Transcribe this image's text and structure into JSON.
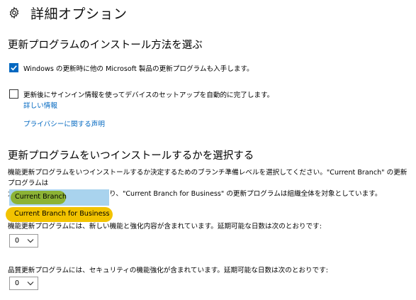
{
  "header": {
    "title": "詳細オプション",
    "icon": "gear-icon"
  },
  "install_section": {
    "title": "更新プログラムのインストール方法を選ぶ",
    "option1": {
      "label": "Windows の更新時に他の Microsoft 製品の更新プログラムも入手します。",
      "checked": true
    },
    "option2": {
      "label": "更新後にサインイン情報を使ってデバイスのセットアップを自動的に完了します。",
      "checked": false
    },
    "details_link": "詳しい情報",
    "privacy_link": "プライバシーに関する声明"
  },
  "timing_section": {
    "title": "更新プログラムをいつインストールするかを選択する",
    "description_line1": "機能更新プログラムをいつインストールするか決定するためのブランチ準備レベルを選択してください。\"Current Branch\" の更新プログラムは",
    "description_line2": "大多数のユーザーを対象としており、\"Current Branch for Business\" の更新プログラムは組織全体を対象としています。",
    "branch_options": [
      "Current Branch",
      "Current Branch for Business"
    ],
    "feature_label": "機能更新プログラムには、新しい機能と強化内容が含まれています。延期可能な日数は次のとおりです:",
    "feature_days": "0",
    "quality_label": "品質更新プログラムには、セキュリティの機能強化が含まれています。延期可能な日数は次のとおりです:",
    "quality_days": "0"
  },
  "colors": {
    "accent": "#0067c0",
    "highlight_green": "#8ab12a",
    "highlight_yellow": "#f2c300",
    "selected_bg": "#a9d3ee"
  }
}
